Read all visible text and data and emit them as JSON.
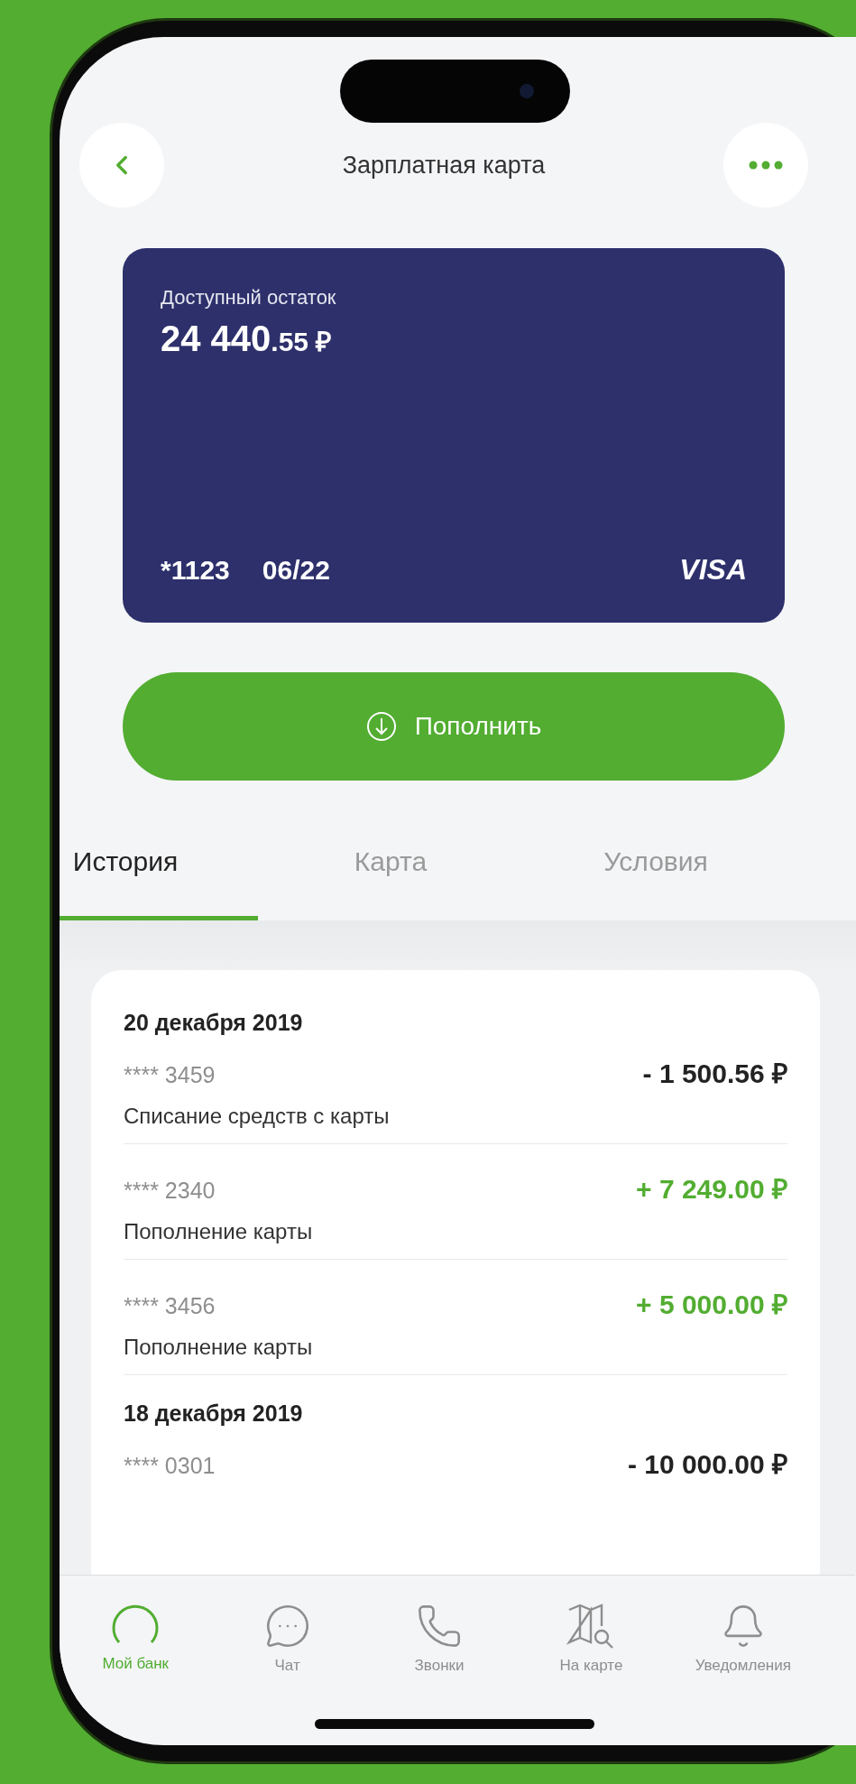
{
  "header": {
    "title": "Зарплатная карта"
  },
  "card": {
    "label": "Доступный остаток",
    "balance_integer": "24 440",
    "balance_fraction": ".55 ₽",
    "number": "*1123",
    "expiry": "06/22",
    "brand": "VISA"
  },
  "top_up_button": {
    "label": "Пополнить"
  },
  "tabs": [
    {
      "label": "История",
      "selected": true
    },
    {
      "label": "Карта",
      "selected": false
    },
    {
      "label": "Условия",
      "selected": false
    }
  ],
  "history": [
    {
      "date": "20 декабря 2019",
      "transactions": [
        {
          "account": "**** 3459",
          "amount": "- 1 500.56 ₽",
          "kind": "debit",
          "description": "Списание средств с карты"
        },
        {
          "account": "**** 2340",
          "amount": "+ 7 249.00 ₽",
          "kind": "credit",
          "description": "Пополнение карты"
        },
        {
          "account": "**** 3456",
          "amount": "+ 5 000.00 ₽",
          "kind": "credit",
          "description": "Пополнение карты"
        }
      ]
    },
    {
      "date": "18 декабря 2019",
      "transactions": [
        {
          "account": "**** 0301",
          "amount": "- 10 000.00 ₽",
          "kind": "debit"
        }
      ]
    }
  ],
  "bottom_nav": [
    {
      "label": "Мой банк",
      "kind": "home",
      "selected": true
    },
    {
      "label": "Чат",
      "kind": "chat",
      "selected": false
    },
    {
      "label": "Звонки",
      "kind": "calls",
      "selected": false
    },
    {
      "label": "На карте",
      "kind": "map",
      "selected": false
    },
    {
      "label": "Уведомления",
      "kind": "notifications",
      "selected": false
    }
  ]
}
